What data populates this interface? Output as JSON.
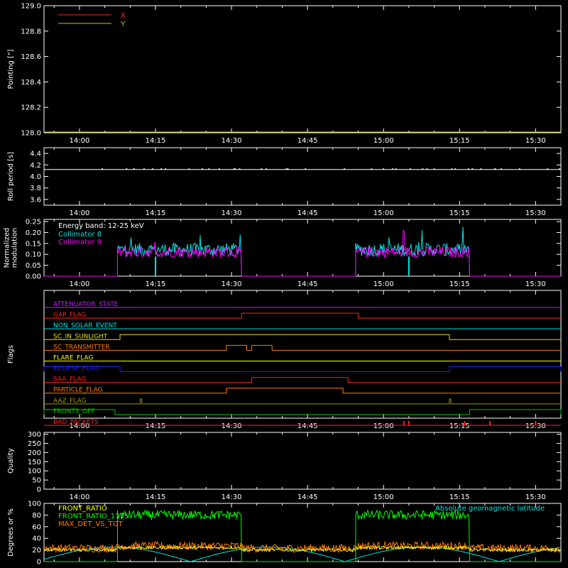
{
  "chart_data": {
    "type": "line",
    "x_ticks": [
      "14:00",
      "14:15",
      "14:30",
      "14:45",
      "15:00",
      "15:15",
      "15:30"
    ],
    "panels": [
      {
        "id": "pointing",
        "ylabel": "Pointing [\"]",
        "yticks": [
          "128.0",
          "128.2",
          "128.4",
          "128.6",
          "128.8",
          "129.0"
        ],
        "ylim": [
          128.0,
          129.0
        ],
        "legend": [
          {
            "name": "X",
            "color": "#ff2020"
          },
          {
            "name": "Y",
            "color": "#c8c800"
          }
        ]
      },
      {
        "id": "roll",
        "ylabel": "Roll period [s]",
        "yticks": [
          "3.6",
          "3.8",
          "4.0",
          "4.2",
          "4.4"
        ],
        "ylim": [
          3.5,
          4.5
        ],
        "value": 4.12
      },
      {
        "id": "modulation",
        "ylabel": [
          "Normalized",
          "modulation"
        ],
        "yticks": [
          "0.00",
          "0.05",
          "0.10",
          "0.15",
          "0.20",
          "0.25"
        ],
        "ylim": [
          0.0,
          0.26
        ],
        "annotation": "Energy band: 12-25 keV",
        "legend": [
          {
            "name": "Collimator 8",
            "color": "#00e5e5"
          },
          {
            "name": "Collimator 9",
            "color": "#ff00ff"
          }
        ],
        "active_intervals": [
          [
            "14:07:30",
            "14:32:00"
          ],
          [
            "14:54:30",
            "15:17:00"
          ]
        ]
      },
      {
        "id": "flags",
        "ylabel": "Flags",
        "rows": [
          {
            "name": "ATTENUATOR_STATE",
            "color": "#c020ff",
            "on": []
          },
          {
            "name": "GAP_FLAG",
            "color": "#ff2020",
            "on": [
              [
                "14:32",
                "14:55"
              ]
            ]
          },
          {
            "name": "NON_SOLAR_EVENT",
            "color": "#00e5e5",
            "on": []
          },
          {
            "name": "SC_IN_SUNLIGHT",
            "color": "#e0e000",
            "on": [
              [
                "14:08",
                "15:13"
              ]
            ]
          },
          {
            "name": "SC_TRANSMITTER",
            "color": "#ff7a00",
            "on": [
              [
                "14:29",
                "14:33"
              ],
              [
                "14:34",
                "14:38"
              ]
            ]
          },
          {
            "name": "FLARE_FLAG",
            "color": "#ffff00",
            "on": []
          },
          {
            "name": "ECLIPSE_FLAG",
            "color": "#2020ff",
            "on": [
              [
                "13:53",
                "14:08"
              ],
              [
                "15:13",
                "15:35"
              ]
            ]
          },
          {
            "name": "SAA_FLAG",
            "color": "#ff2020",
            "on": [
              [
                "14:34",
                "14:53"
              ]
            ]
          },
          {
            "name": "PARTICLE_FLAG",
            "color": "#ff7a00",
            "on": [
              [
                "14:29",
                "14:52"
              ]
            ]
          },
          {
            "name": "AAZ_FLAG",
            "color": "#999900",
            "on": [
              [
                "14:12",
                "14:12"
              ],
              [
                "15:13",
                "15:13"
              ]
            ]
          },
          {
            "name": "FRONTS_OFF",
            "color": "#00c800",
            "on": [
              [
                "13:53",
                "14:07"
              ],
              [
                "15:17",
                "15:35"
              ]
            ]
          },
          {
            "name": "BAD_PACKETS",
            "color": "#ff2020",
            "on": [],
            "spikes": [
              "15:04",
              "15:05",
              "15:16",
              "15:21",
              "15:30"
            ]
          }
        ]
      },
      {
        "id": "quality",
        "ylabel": "Quality",
        "yticks": [
          "0",
          "50",
          "100",
          "150",
          "200",
          "250",
          "300"
        ],
        "ylim": [
          0,
          310
        ],
        "value": 0
      },
      {
        "id": "ratios",
        "ylabel": "Degrees or %",
        "yticks": [
          "0",
          "20",
          "40",
          "60",
          "80",
          "100"
        ],
        "ylim": [
          0,
          100
        ],
        "legend": [
          {
            "name": "FRONT_RATIO",
            "color": "#ffff00"
          },
          {
            "name": "FRONT_RATIO_1135",
            "color": "#00ff00"
          },
          {
            "name": "MAX_DET_VS_TOT",
            "color": "#ff7a00"
          }
        ],
        "annotation": "Absolute geomagnetic latitude",
        "series": [
          {
            "name": "FRONT_RATIO",
            "typical": 22
          },
          {
            "name": "FRONT_RATIO_1135",
            "typical": 80
          },
          {
            "name": "MAX_DET_VS_TOT",
            "typical": 25
          }
        ],
        "active_intervals": [
          [
            "14:07:30",
            "14:32:00"
          ],
          [
            "14:54:30",
            "15:17:00"
          ]
        ]
      }
    ]
  }
}
